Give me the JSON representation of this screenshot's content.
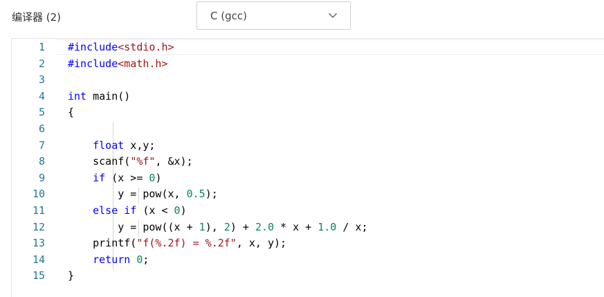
{
  "header": {
    "compiler_label": "编译器 (2)",
    "compiler_selected": "C (gcc)",
    "dropdown_icon": "chevron-down-icon"
  },
  "colors": {
    "keyword": "#0000ff",
    "string": "#a31515",
    "number": "#098658",
    "line_number": "#237893",
    "plain": "#000000"
  },
  "editor": {
    "lines": [
      {
        "n": "1",
        "tokens": [
          {
            "t": "#include",
            "c": "kw"
          },
          {
            "t": "<stdio.h>",
            "c": "str"
          }
        ]
      },
      {
        "n": "2",
        "tokens": [
          {
            "t": "#include",
            "c": "kw"
          },
          {
            "t": "<math.h>",
            "c": "str"
          }
        ]
      },
      {
        "n": "3",
        "tokens": []
      },
      {
        "n": "4",
        "tokens": [
          {
            "t": "int",
            "c": "kw"
          },
          {
            "t": " main()",
            "c": "plain"
          }
        ]
      },
      {
        "n": "5",
        "tokens": [
          {
            "t": "{",
            "c": "plain"
          }
        ]
      },
      {
        "n": "6",
        "tokens": []
      },
      {
        "n": "7",
        "tokens": [
          {
            "t": "    ",
            "c": "plain"
          },
          {
            "t": "float",
            "c": "kw"
          },
          {
            "t": " x,y;",
            "c": "plain"
          }
        ]
      },
      {
        "n": "8",
        "tokens": [
          {
            "t": "    scanf(",
            "c": "plain"
          },
          {
            "t": "\"%f\"",
            "c": "str"
          },
          {
            "t": ", &x);",
            "c": "plain"
          }
        ]
      },
      {
        "n": "9",
        "tokens": [
          {
            "t": "    ",
            "c": "plain"
          },
          {
            "t": "if",
            "c": "kw"
          },
          {
            "t": " (x >= ",
            "c": "plain"
          },
          {
            "t": "0",
            "c": "num"
          },
          {
            "t": ")",
            "c": "plain"
          }
        ]
      },
      {
        "n": "10",
        "tokens": [
          {
            "t": "        y = pow(x, ",
            "c": "plain"
          },
          {
            "t": "0.5",
            "c": "num"
          },
          {
            "t": ");",
            "c": "plain"
          }
        ]
      },
      {
        "n": "11",
        "tokens": [
          {
            "t": "    ",
            "c": "plain"
          },
          {
            "t": "else",
            "c": "kw"
          },
          {
            "t": " ",
            "c": "plain"
          },
          {
            "t": "if",
            "c": "kw"
          },
          {
            "t": " (x < ",
            "c": "plain"
          },
          {
            "t": "0",
            "c": "num"
          },
          {
            "t": ")",
            "c": "plain"
          }
        ]
      },
      {
        "n": "12",
        "tokens": [
          {
            "t": "        y = pow((x + ",
            "c": "plain"
          },
          {
            "t": "1",
            "c": "num"
          },
          {
            "t": "), ",
            "c": "plain"
          },
          {
            "t": "2",
            "c": "num"
          },
          {
            "t": ") + ",
            "c": "plain"
          },
          {
            "t": "2.0",
            "c": "num"
          },
          {
            "t": " * x + ",
            "c": "plain"
          },
          {
            "t": "1.0",
            "c": "num"
          },
          {
            "t": " / x;",
            "c": "plain"
          }
        ]
      },
      {
        "n": "13",
        "tokens": [
          {
            "t": "    printf(",
            "c": "plain"
          },
          {
            "t": "\"f(%.2f) = %.2f\"",
            "c": "str"
          },
          {
            "t": ", x, y);",
            "c": "plain"
          }
        ]
      },
      {
        "n": "14",
        "tokens": [
          {
            "t": "    ",
            "c": "plain"
          },
          {
            "t": "return",
            "c": "kw"
          },
          {
            "t": " ",
            "c": "plain"
          },
          {
            "t": "0",
            "c": "num"
          },
          {
            "t": ";",
            "c": "plain"
          }
        ]
      },
      {
        "n": "15",
        "tokens": [
          {
            "t": "}",
            "c": "plain"
          }
        ]
      }
    ]
  }
}
